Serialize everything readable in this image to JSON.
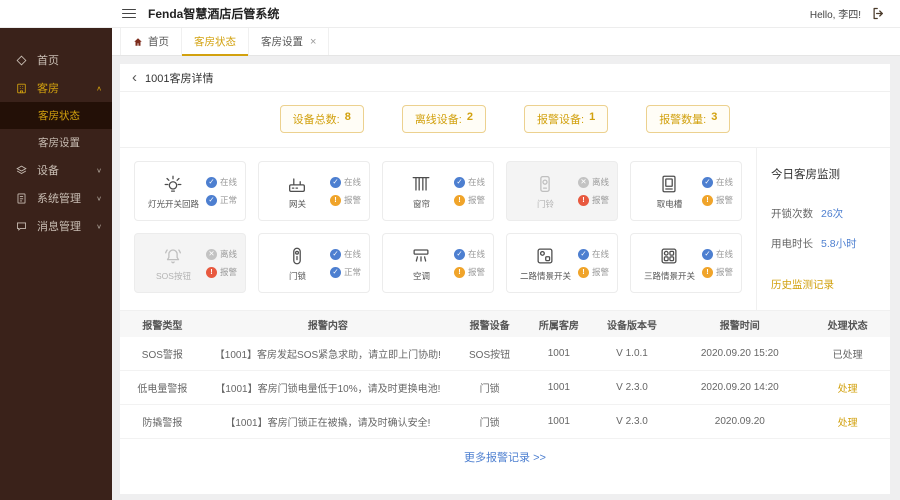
{
  "header": {
    "title": "Fenda智慧酒店后管系统",
    "greeting": "Hello, 李四!"
  },
  "sidebar": {
    "home": "首页",
    "rooms": "客房",
    "room_status": "客房状态",
    "room_settings": "客房设置",
    "devices": "设备",
    "system": "系统管理",
    "messages": "消息管理",
    "chevron_up": "∧",
    "chevron_down": "∨"
  },
  "tabs": {
    "home": "首页",
    "room_status": "客房状态",
    "room_settings": "客房设置",
    "close": "×"
  },
  "breadcrumb": {
    "back": "‹",
    "title": "1001客房详情"
  },
  "stats": [
    {
      "label": "设备总数:",
      "value": "8"
    },
    {
      "label": "离线设备:",
      "value": "2"
    },
    {
      "label": "报警设备:",
      "value": "1"
    },
    {
      "label": "报警数量:",
      "value": "3"
    }
  ],
  "devices": [
    {
      "name": "灯光开关回路",
      "statuses": [
        {
          "text": "在线",
          "type": "ok"
        },
        {
          "text": "正常",
          "type": "ok"
        }
      ]
    },
    {
      "name": "网关",
      "statuses": [
        {
          "text": "在线",
          "type": "ok"
        },
        {
          "text": "报警",
          "type": "warn"
        }
      ]
    },
    {
      "name": "窗帘",
      "statuses": [
        {
          "text": "在线",
          "type": "ok"
        },
        {
          "text": "报警",
          "type": "warn"
        }
      ]
    },
    {
      "name": "门铃",
      "offline": "true",
      "statuses": [
        {
          "text": "离线",
          "type": "off"
        },
        {
          "text": "报警",
          "type": "alarm"
        }
      ]
    },
    {
      "name": "取电槽",
      "statuses": [
        {
          "text": "在线",
          "type": "ok"
        },
        {
          "text": "报警",
          "type": "warn"
        }
      ]
    },
    {
      "name": "SOS按钮",
      "offline": "true",
      "statuses": [
        {
          "text": "离线",
          "type": "off"
        },
        {
          "text": "报警",
          "type": "alarm"
        }
      ]
    },
    {
      "name": "门锁",
      "statuses": [
        {
          "text": "在线",
          "type": "ok"
        },
        {
          "text": "正常",
          "type": "ok"
        }
      ]
    },
    {
      "name": "空调",
      "statuses": [
        {
          "text": "在线",
          "type": "ok"
        },
        {
          "text": "报警",
          "type": "warn"
        }
      ]
    },
    {
      "name": "二路情景开关",
      "statuses": [
        {
          "text": "在线",
          "type": "ok"
        },
        {
          "text": "报警",
          "type": "warn"
        }
      ]
    },
    {
      "name": "三路情景开关",
      "statuses": [
        {
          "text": "在线",
          "type": "ok"
        },
        {
          "text": "报警",
          "type": "warn"
        }
      ]
    }
  ],
  "monitor": {
    "title": "今日客房监测",
    "unlock_label": "开锁次数",
    "unlock_value": "26次",
    "power_label": "用电时长",
    "power_value": "5.8小时",
    "history_link": "历史监测记录"
  },
  "table": {
    "headers": [
      "报警类型",
      "报警内容",
      "报警设备",
      "所属客房",
      "设备版本号",
      "报警时间",
      "处理状态"
    ],
    "rows": [
      {
        "type": "SOS警报",
        "content": "【1001】客房发起SOS紧急求助，请立即上门协助!",
        "device": "SOS按钮",
        "room": "1001",
        "version": "V 1.0.1",
        "time": "2020.09.20 15:20",
        "action": "已处理",
        "action_state": "done"
      },
      {
        "type": "低电量警报",
        "content": "【1001】客房门锁电量低于10%，请及时更换电池!",
        "device": "门锁",
        "room": "1001",
        "version": "V 2.3.0",
        "time": "2020.09.20 14:20",
        "action": "处理",
        "action_state": "pending"
      },
      {
        "type": "防撬警报",
        "content": "【1001】客房门锁正在被撬，请及时确认安全!",
        "device": "门锁",
        "room": "1001",
        "version": "V 2.3.0",
        "time": "2020.09.20",
        "action": "处理",
        "action_state": "pending"
      }
    ]
  },
  "footer": {
    "more": "更多报警记录 >>"
  }
}
